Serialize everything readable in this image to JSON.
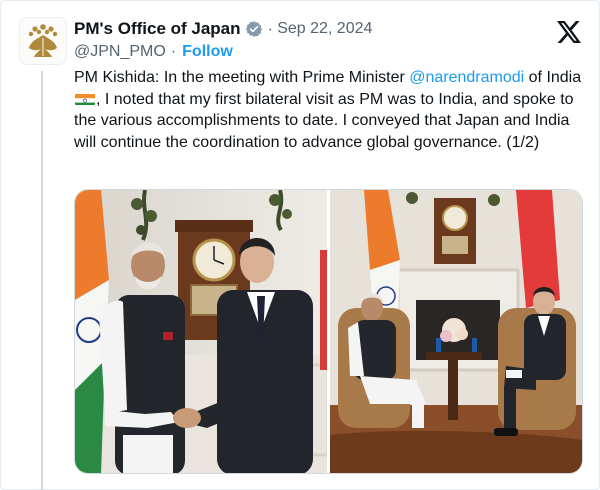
{
  "account": {
    "display_name": "PM's Office of Japan",
    "handle": "@JPN_PMO",
    "date": "Sep 22, 2024",
    "follow_label": "Follow",
    "avatar_icon": "paulownia-crest-icon",
    "verified_icon": "verified-badge-icon",
    "verified_color": "#829aab"
  },
  "post": {
    "text_intro": "PM Kishida: In the meeting with Prime Minister ",
    "mention": "@narendramodi",
    "text_mid": " of India",
    "flag": "india-flag-emoji",
    "text_rest": ", I noted that my first bilateral visit as PM was to India, and spoke to the various accomplishments to date. I conveyed that Japan and India will continue the coordination to advance global governance. (1/2)"
  },
  "colors": {
    "link": "#1d9bf0",
    "secondary_text": "#536471",
    "primary_text": "#0f1419"
  },
  "media": {
    "photos": [
      {
        "name": "photo-handshake"
      },
      {
        "name": "photo-seated-meeting"
      }
    ]
  },
  "brand_icon": "x-logo-icon"
}
